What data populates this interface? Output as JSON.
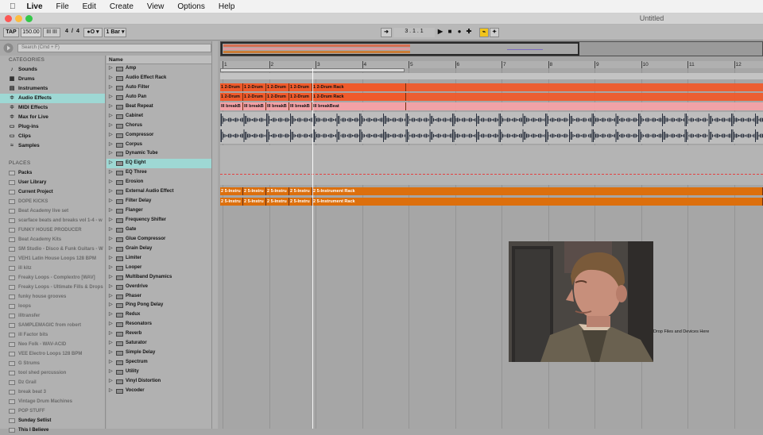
{
  "menubar": {
    "apple": "",
    "items": [
      "Live",
      "File",
      "Edit",
      "Create",
      "View",
      "Options",
      "Help"
    ]
  },
  "window": {
    "title": "Untitled",
    "traffic": [
      "#fc5753",
      "#fdbc40",
      "#33c748"
    ]
  },
  "transport": {
    "tap": "TAP",
    "tempo": "150.00",
    "nudge": "III III",
    "sig_num": "4",
    "sig_den": "4",
    "metro": "●O ▾",
    "quantize": "1 Bar ▾",
    "loop_icon": "arrow-follow-icon",
    "position": "3 .   1 .   1",
    "play": "▶",
    "stop": "■",
    "record": "●",
    "add": "✚",
    "draw_a": "⌁",
    "draw_b": "✦"
  },
  "browser": {
    "search_placeholder": "Search (Cmd + F)",
    "categories_header": "CATEGORIES",
    "categories": [
      {
        "label": "Sounds",
        "icon": "♪"
      },
      {
        "label": "Drums",
        "icon": "▦"
      },
      {
        "label": "Instruments",
        "icon": "▤"
      },
      {
        "label": "Audio Effects",
        "icon": "≑"
      },
      {
        "label": "MIDI Effects",
        "icon": "≑"
      },
      {
        "label": "Max for Live",
        "icon": "≑"
      },
      {
        "label": "Plug-ins",
        "icon": "▭"
      },
      {
        "label": "Clips",
        "icon": "▭"
      },
      {
        "label": "Samples",
        "icon": "≈"
      }
    ],
    "places_header": "PLACES",
    "places": [
      "Packs",
      "User Library",
      "Current Project",
      "DOPE KICKS",
      "Beat Academy live set",
      "scarface beats and breaks vol 1-4 - w",
      "FUNKY HOUSE PRODUCER",
      "Beat Academy Kits",
      "SM Studio - Disco & Funk Guitars - W",
      "VEH1 Latin House Loops 128 BPM",
      "ill kitz",
      "Freaky Loops - Complextro [WAV]",
      "Freaky Loops - Ultimate Fills & Drops",
      "funky house grooves",
      "loops",
      "illtransfer",
      "SAMPLEMAGIC from robert",
      "ill Factor bits",
      "Neo Folk - WAV-ACID",
      "VEE Electro Loops 128 BPM",
      "G Strums",
      "tool shed percussion",
      "Dz Grail",
      "break beat 3",
      "Vintage Drum Machines",
      "POP STUFF",
      "Sunday Setlist",
      "This I Believe"
    ],
    "names_header": "Name",
    "names": [
      "Amp",
      "Audio Effect Rack",
      "Auto Filter",
      "Auto Pan",
      "Beat Repeat",
      "Cabinet",
      "Chorus",
      "Compressor",
      "Corpus",
      "Dynamic Tube",
      "EQ Eight",
      "EQ Three",
      "Erosion",
      "External Audio Effect",
      "Filter Delay",
      "Flanger",
      "Frequency Shifter",
      "Gate",
      "Glue Compressor",
      "Grain Delay",
      "Limiter",
      "Looper",
      "Multiband Dynamics",
      "Overdrive",
      "Phaser",
      "Ping Pong Delay",
      "Redux",
      "Resonators",
      "Reverb",
      "Saturator",
      "Simple Delay",
      "Spectrum",
      "Utility",
      "Vinyl Distortion",
      "Vocoder"
    ]
  },
  "arrangement": {
    "bars": [
      "1",
      "2",
      "3",
      "4",
      "5",
      "6",
      "7",
      "8",
      "9",
      "10",
      "11",
      "12"
    ],
    "drum_clip": "1 2-Drum",
    "drum_rack": "1 2-Drum Rack",
    "break_clip": "lll breakB",
    "break_full": "lll breakBeat",
    "inst_clip": "2 5-Instru",
    "inst_rack": "2 5-Instrument Rack",
    "drop_text": "Drop Files and Devices Here",
    "colors": {
      "drum": "#ef5a2b",
      "break": "#f3a1a6",
      "inst": "#dc6f0d"
    }
  }
}
